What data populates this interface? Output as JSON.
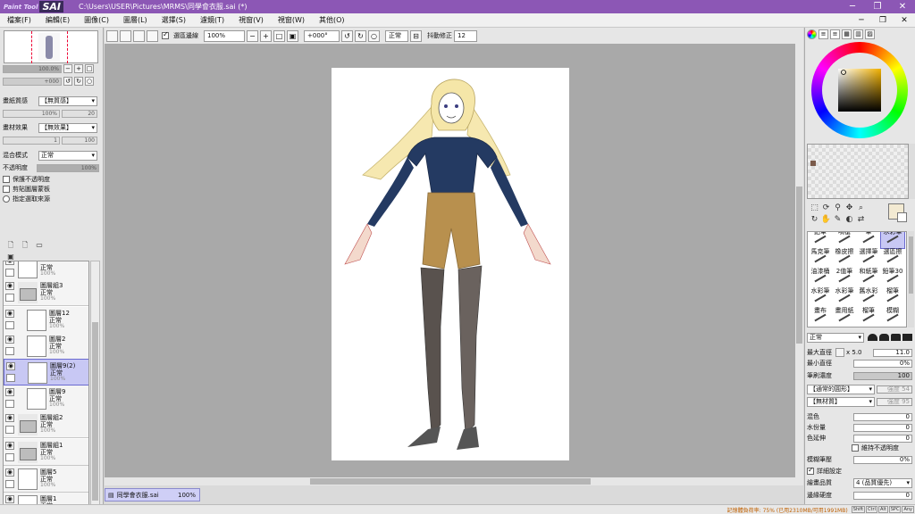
{
  "window": {
    "logo_paint": "Paint Tool",
    "logo_sai": "SAI",
    "title": "C:\\Users\\USER\\Pictures\\MRMS\\同學會衣服.sai (*)",
    "minimize": "─",
    "maximize": "❐",
    "close": "✕"
  },
  "menu": [
    "檔案(F)",
    "編輯(E)",
    "圖像(C)",
    "圖層(L)",
    "選擇(S)",
    "濾鏡(T)",
    "視窗(V)",
    "視窗(W)",
    "其他(O)"
  ],
  "menu_right": [
    "─",
    "❐",
    "✕"
  ],
  "left": {
    "nav_zoom_label": "縮放比率",
    "nav_zoom_value": "100.0%",
    "nav_rotate_label": "旋轉角度",
    "nav_rotate_value": "+000",
    "paper_texture_label": "畫紙質感",
    "paper_texture_value": "【無質感】",
    "paper_scale_label": "倍率",
    "paper_scale_value": "100%",
    "paper_strength_label": "強度",
    "paper_strength_value": "20",
    "material_label": "畫材效果",
    "material_value": "【無效果】",
    "material_level_label": "程度",
    "material_level_value": "1",
    "material_strength_label": "強度",
    "material_strength_value": "100",
    "blend_label": "混合模式",
    "blend_value": "正常",
    "opacity_label": "不透明度",
    "opacity_value": "100%",
    "opacity_level": 1.0,
    "check1": "保護不透明度",
    "check2": "剪貼圖層蒙板",
    "check3": "指定選取來源"
  },
  "layers": [
    {
      "name": "",
      "mode": "正常",
      "opacity": "100%",
      "folder": false,
      "selected": false
    },
    {
      "name": "圖層組3",
      "mode": "正常",
      "opacity": "100%",
      "folder": true,
      "selected": false
    },
    {
      "name": "圖層12",
      "mode": "正常",
      "opacity": "100%",
      "folder": false,
      "selected": false
    },
    {
      "name": "圖層2",
      "mode": "正常",
      "opacity": "100%",
      "folder": false,
      "selected": false
    },
    {
      "name": "圖層9(2)",
      "mode": "正常",
      "opacity": "100%",
      "folder": false,
      "selected": true
    },
    {
      "name": "圖層9",
      "mode": "正常",
      "opacity": "100%",
      "folder": false,
      "selected": false
    },
    {
      "name": "圖層組2",
      "mode": "正常",
      "opacity": "100%",
      "folder": true,
      "selected": false
    },
    {
      "name": "圖層組1",
      "mode": "正常",
      "opacity": "100%",
      "folder": true,
      "selected": false
    },
    {
      "name": "圖層5",
      "mode": "正常",
      "opacity": "100%",
      "folder": false,
      "selected": false
    },
    {
      "name": "圖層1",
      "mode": "正常",
      "opacity": "7%",
      "folder": false,
      "selected": false
    }
  ],
  "toolbar": {
    "select_edge_label": "選區邊線",
    "zoom_value": "100%",
    "rotate_value": "+000°",
    "mode_value": "正常",
    "stabilizer_label": "抖動修正",
    "stabilizer_value": "12"
  },
  "doc_tab": {
    "name": "同學會衣服.sai",
    "zoom": "100%"
  },
  "status": {
    "keys": [
      "Shift",
      "Ctrl",
      "Alt",
      "SPC",
      "Any"
    ],
    "memory": "記憶體負荷率: 75% (已用2310MB/可用1991MB)"
  },
  "colors": {
    "accent": "#8c57b5",
    "selection": "#c8c8f4",
    "foreground": "#f3ead2",
    "background": "#ffffff"
  },
  "brush_tools": [
    "鉛筆",
    "噴槍",
    "筆",
    "水彩筆",
    "馬克筆",
    "橡皮擦",
    "選擇筆",
    "選區擦",
    "油漆桶",
    "2值筆",
    "和紙筆",
    "鉛筆30",
    "水彩筆",
    "水彩筆",
    "舊水彩",
    "榴筆",
    "畫布",
    "畫用紙",
    "榴筆",
    "模糊"
  ],
  "tool_params": {
    "mode": "正常",
    "max_size_label": "最大直徑",
    "max_size_mult": "x 5.0",
    "max_size_value": "11.0",
    "min_size_label": "最小直徑",
    "min_size_value": "0%",
    "density_label": "筆刷濃度",
    "density_value": "100",
    "shape_value": "【通常的圓形】",
    "shape_strength": "強度 54",
    "texture_value": "【無材質】",
    "texture_strength": "強度 95",
    "blend_label": "混色",
    "blend_value": "0",
    "water_label": "水份量",
    "water_value": "0",
    "persist_label": "色延伸",
    "persist_value": "0",
    "keep_opacity_label": "維持不透明度",
    "blur_label": "模糊筆壓",
    "blur_value": "0%",
    "detail_label": "詳細設定",
    "quality_label": "繪畫品質",
    "quality_value": "4 (品質優先)",
    "edge_label": "邊緣硬度",
    "edge_value": "0"
  }
}
